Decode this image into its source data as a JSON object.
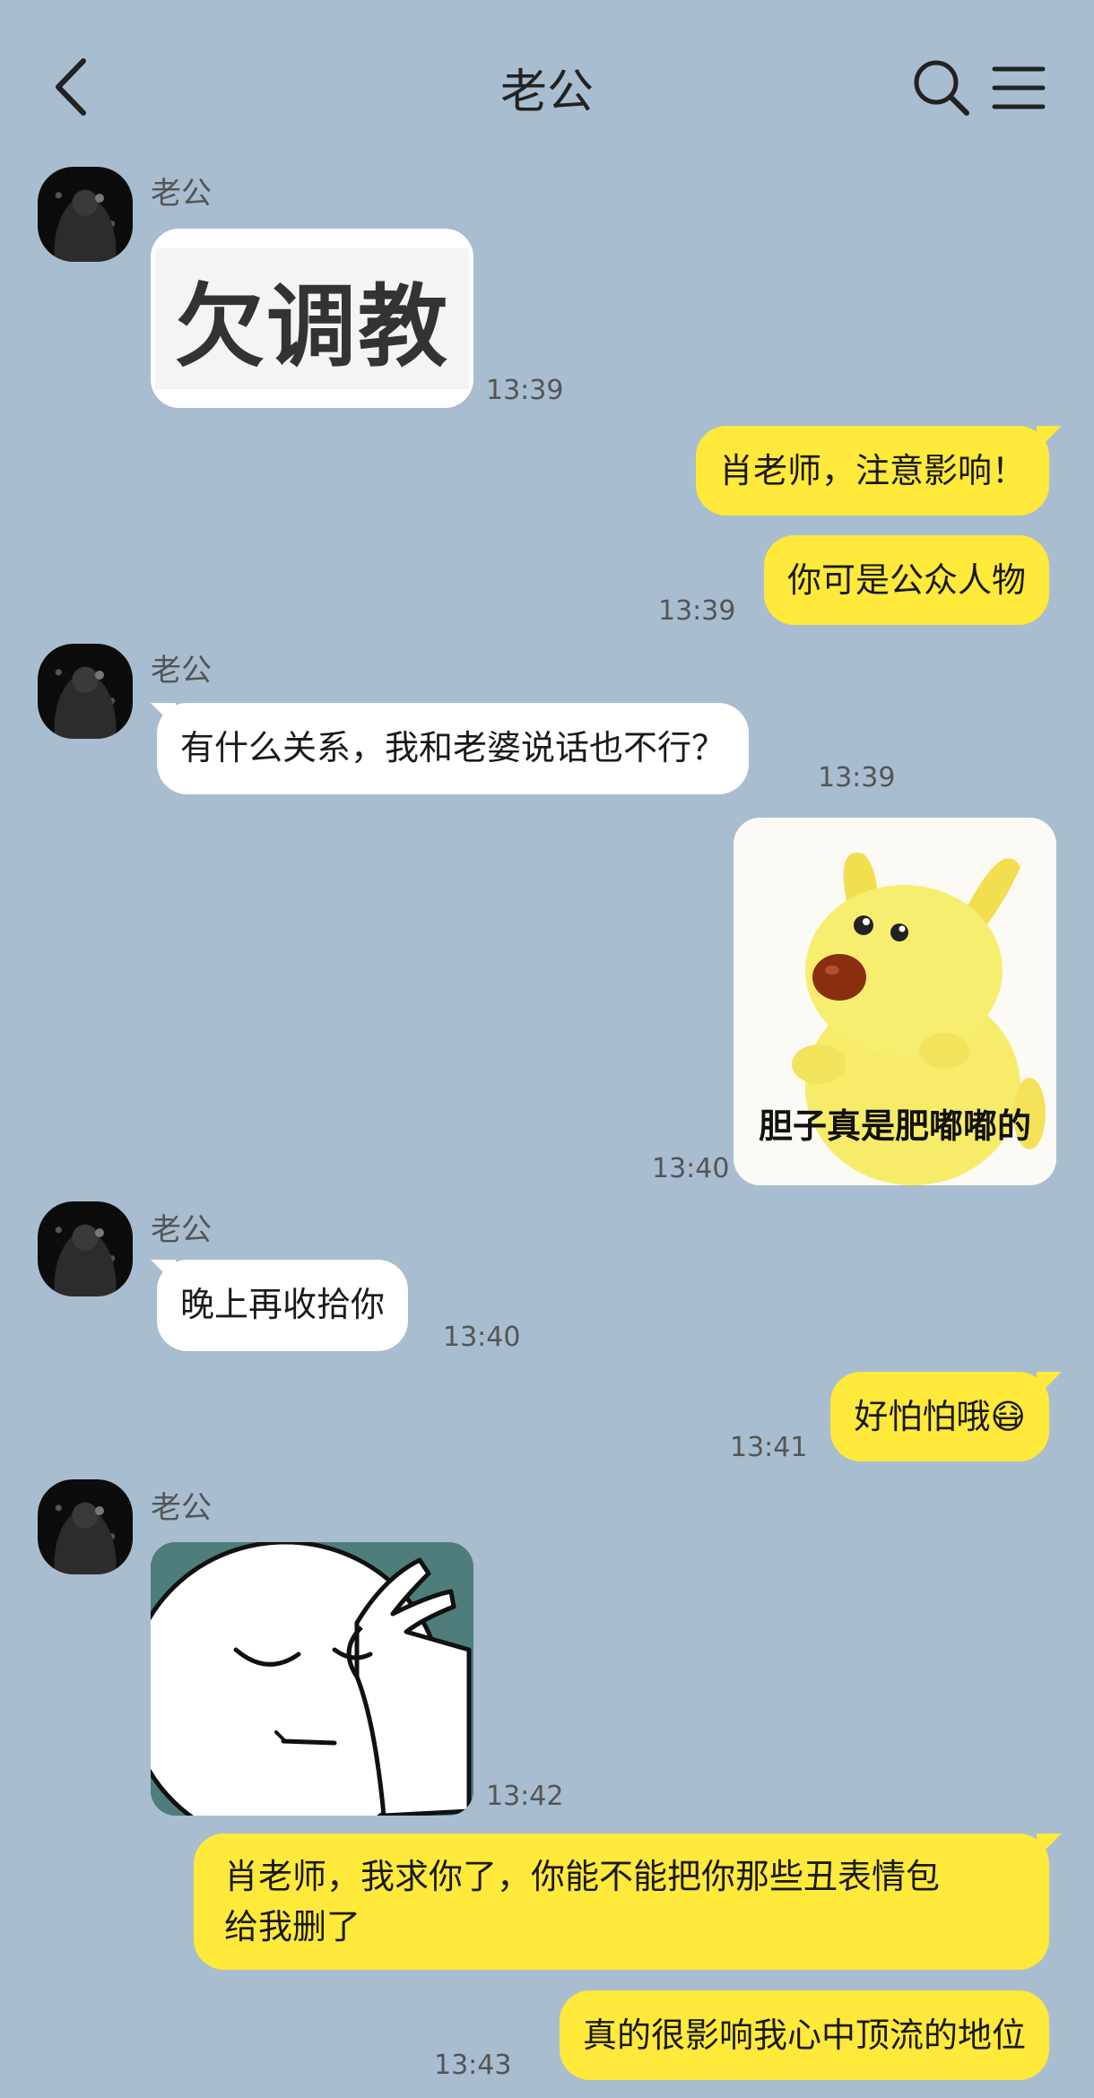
{
  "header": {
    "title": "老公"
  },
  "icons": {
    "back": "chevron-left-icon",
    "search": "search-icon",
    "menu": "menu-icon"
  },
  "colors": {
    "background": "#a9bdd0",
    "outgoing_bubble": "#ffe93b",
    "incoming_bubble": "#ffffff"
  },
  "messages": {
    "m1": {
      "sender": "老公",
      "sticker_text": "欠调教",
      "time": "13:39"
    },
    "m2": {
      "text": "肖老师，注意影响！"
    },
    "m3": {
      "text": "你可是公众人物",
      "time": "13:39"
    },
    "m4": {
      "sender": "老公",
      "text": "有什么关系，我和老婆说话也不行？",
      "time": "13:39"
    },
    "m5": {
      "sticker_caption": "胆子真是肥嘟嘟的",
      "time": "13:40"
    },
    "m6": {
      "sender": "老公",
      "text": "晚上再收拾你",
      "time": "13:40"
    },
    "m7": {
      "text": "好怕怕哦",
      "emoji": "😷",
      "time": "13:41"
    },
    "m8": {
      "sender": "老公",
      "time": "13:42"
    },
    "m9": {
      "line1": "肖老师，我求你了，你能不能把你那些丑表情包",
      "line2": "给我删了"
    },
    "m10": {
      "text": "真的很影响我心中顶流的地位",
      "time": "13:43"
    }
  }
}
